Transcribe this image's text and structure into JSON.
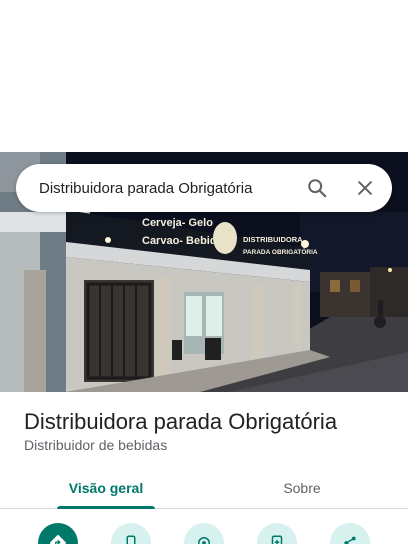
{
  "search": {
    "query": "Distribuidora parada Obrigatória"
  },
  "place": {
    "name": "Distribuidora parada Obrigatória",
    "category": "Distribuidor de bebidas"
  },
  "photo": {
    "sign_left": [
      "Cerveja- Gelo",
      "Carvao- Bebidas"
    ],
    "sign_right": [
      "DISTRIBUIDORA",
      "PARADA OBRIGATÓRIA"
    ]
  },
  "tabs": [
    {
      "label": "Visão geral",
      "selected": true
    },
    {
      "label": "Sobre",
      "selected": false
    }
  ],
  "actions": [
    {
      "icon": "directions-icon"
    },
    {
      "icon": "phone-icon"
    },
    {
      "icon": "location-icon"
    },
    {
      "icon": "save-to-phone-icon"
    },
    {
      "icon": "share-icon"
    }
  ],
  "colors": {
    "accent": "#00796b",
    "accent_light": "#d7f1ee",
    "text": "#202124",
    "secondary_text": "#5f6368"
  }
}
